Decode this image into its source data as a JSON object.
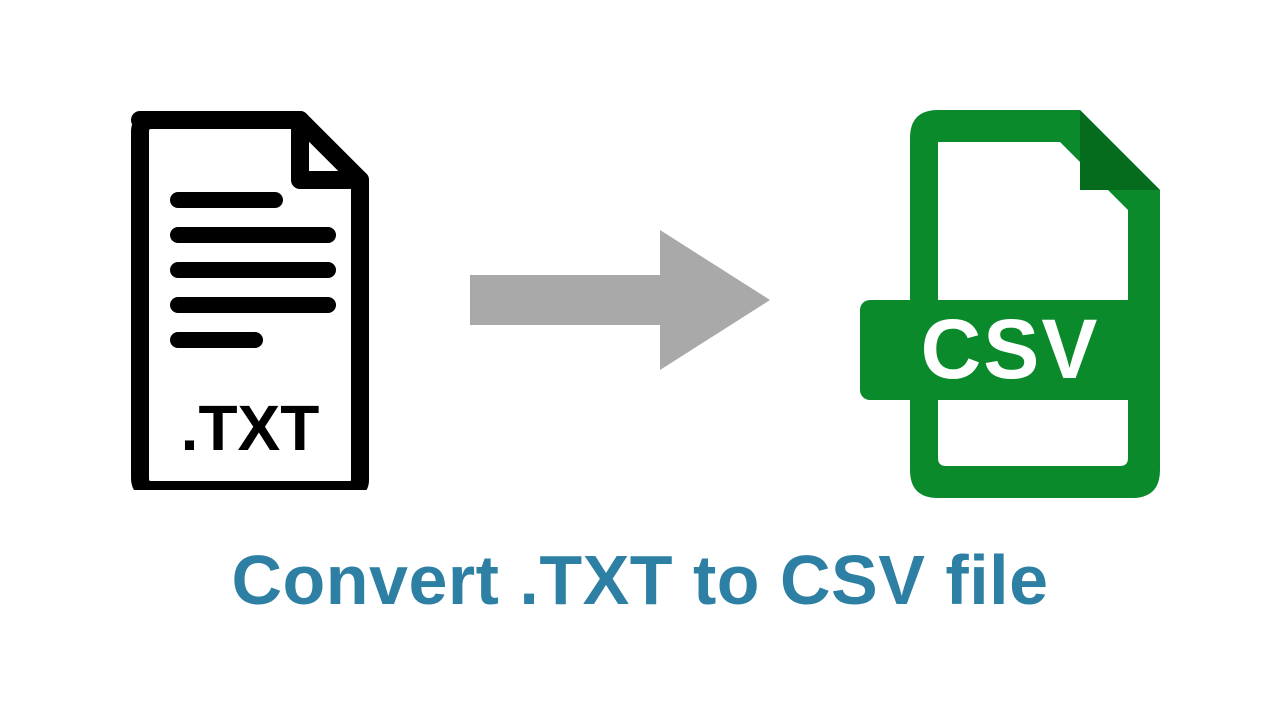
{
  "diagram": {
    "caption": "Convert .TXT to CSV file",
    "source": {
      "label": ".TXT",
      "type": "text-file"
    },
    "target": {
      "label": "CSV",
      "type": "csv-file"
    },
    "colors": {
      "txt_stroke": "#000000",
      "arrow_fill": "#a9a9a9",
      "csv_fill": "#0a8a2a",
      "caption_text": "#2d7fa3"
    }
  }
}
